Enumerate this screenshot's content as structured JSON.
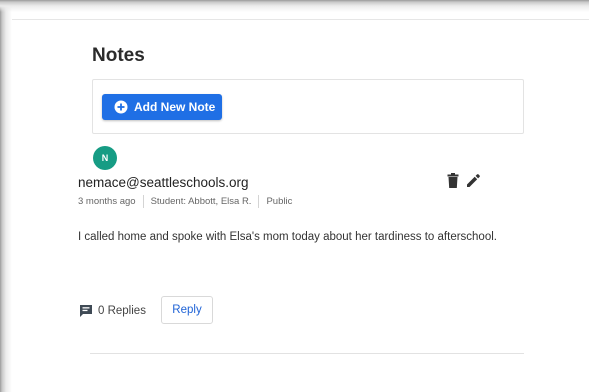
{
  "notes": {
    "title": "Notes",
    "add_button_label": "Add New Note",
    "add_icon": "plus-circle-icon"
  },
  "note": {
    "avatar_initial": "N",
    "avatar_color": "#169c84",
    "author": "nemace@seattleschools.org",
    "time": "3 months ago",
    "student": "Student: Abbott, Elsa R.",
    "visibility": "Public",
    "text": "I called home and spoke with Elsa's mom today about her tardiness to afterschool.",
    "delete_icon": "trash-icon",
    "edit_icon": "pencil-icon",
    "replies_icon": "comment-icon",
    "replies_label": "0 Replies",
    "reply_button_label": "Reply"
  },
  "colors": {
    "primary": "#1f6fe5",
    "link": "#1f63d6"
  }
}
